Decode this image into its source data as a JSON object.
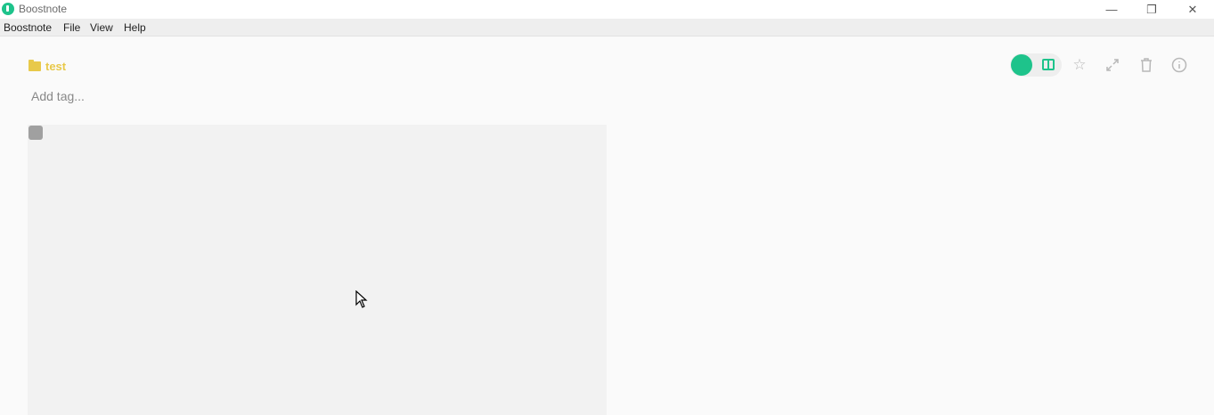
{
  "window": {
    "title": "Boostnote",
    "minimize_glyph": "—",
    "maximize_glyph": "❐",
    "close_glyph": "✕"
  },
  "menu": [
    "Boostnote",
    "File",
    "View",
    "Help"
  ],
  "note": {
    "folder_name": "test",
    "tag_placeholder": "Add tag..."
  },
  "colors": {
    "accent": "#1ec38b",
    "folder": "#e8c94a",
    "icon_muted": "#b8b8b8"
  },
  "icons": [
    "app-logo-icon",
    "folder-icon",
    "split-view-icon",
    "star-icon",
    "expand-icon",
    "trash-icon",
    "info-icon",
    "mouse-cursor-icon"
  ]
}
